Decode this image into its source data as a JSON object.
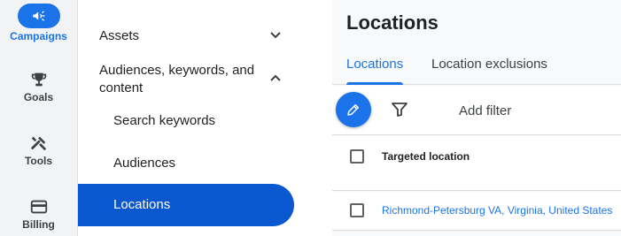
{
  "rail": {
    "items": [
      {
        "label": "Campaigns",
        "icon": "megaphone-icon",
        "active": true
      },
      {
        "label": "Goals",
        "icon": "trophy-icon",
        "active": false
      },
      {
        "label": "Tools",
        "icon": "tools-icon",
        "active": false
      },
      {
        "label": "Billing",
        "icon": "credit-card-icon",
        "active": false
      }
    ]
  },
  "nav": {
    "assets_label": "Assets",
    "audiences_group_label_line1": "Audiences, keywords, and",
    "audiences_group_label_line2": "content",
    "sub_items": [
      "Search keywords",
      "Audiences",
      "Locations"
    ],
    "active_item": "Locations"
  },
  "main": {
    "title": "Locations",
    "tabs": [
      {
        "label": "Locations",
        "active": true
      },
      {
        "label": "Location exclusions",
        "active": false
      }
    ],
    "toolbar": {
      "edit_icon": "pencil-icon",
      "filter_icon": "filter-icon",
      "add_filter_label": "Add filter"
    },
    "table": {
      "column_header": "Targeted location",
      "rows": [
        {
          "location": "Richmond-Petersburg VA, Virginia, United States"
        }
      ]
    }
  },
  "colors": {
    "accent": "#1a73e8",
    "nav_active": "#0b57d0",
    "rail_bg": "#f1f3f4"
  }
}
